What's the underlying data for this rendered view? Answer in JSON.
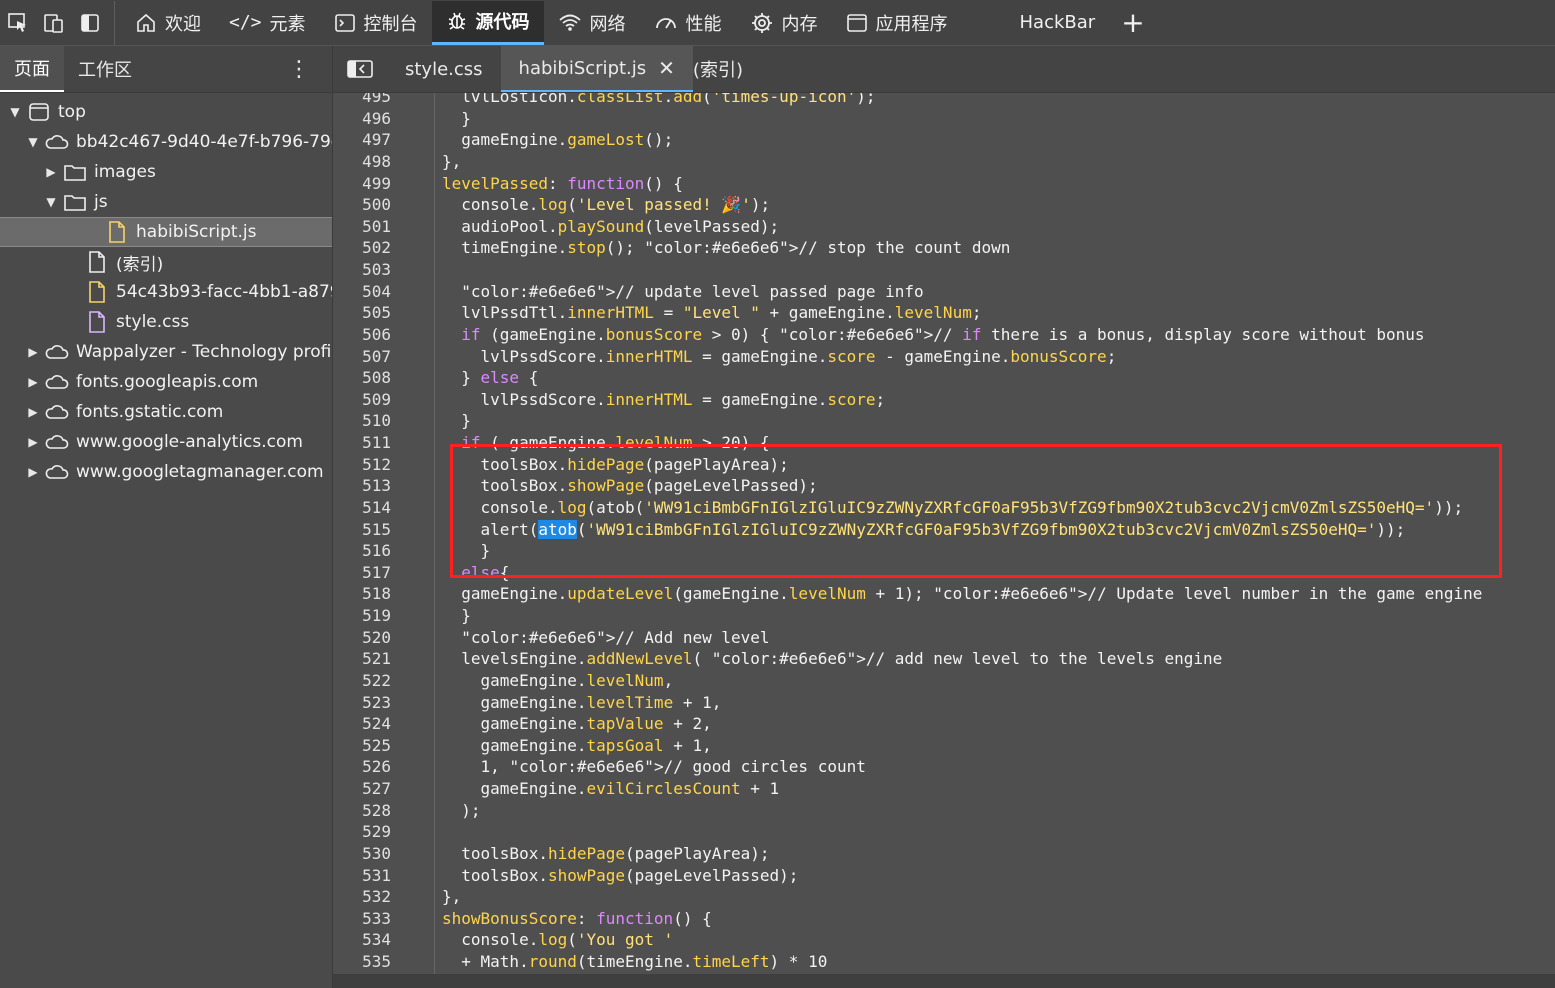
{
  "topbar": {
    "tabs": [
      {
        "icon": "home-icon",
        "label": "欢迎"
      },
      {
        "icon": "elements-icon",
        "label": "元素"
      },
      {
        "icon": "console-icon",
        "label": "控制台"
      },
      {
        "icon": "sources-bug-icon",
        "label": "源代码"
      },
      {
        "icon": "wifi-icon",
        "label": "网络"
      },
      {
        "icon": "performance-icon",
        "label": "性能"
      },
      {
        "icon": "memory-gear-icon",
        "label": "内存"
      },
      {
        "icon": "application-icon",
        "label": "应用程序"
      },
      {
        "icon": "",
        "label": "HackBar"
      }
    ],
    "plus": "+"
  },
  "sidebar": {
    "tabs": [
      "页面",
      "工作区"
    ],
    "kebab": "⋮",
    "tree": [
      {
        "label": "top",
        "icon": "window-icon",
        "caret": "▼"
      },
      {
        "label": "bb42c467-9d40-4e7f-b796-79e",
        "icon": "cloud-icon",
        "caret": "▼"
      },
      {
        "label": "images",
        "icon": "folder-icon",
        "caret": "▶"
      },
      {
        "label": "js",
        "icon": "folder-icon",
        "caret": "▼"
      },
      {
        "label": "habibiScript.js",
        "icon": "js-file-icon",
        "caret": ""
      },
      {
        "label": "(索引)",
        "icon": "file-icon",
        "caret": ""
      },
      {
        "label": "54c43b93-facc-4bb1-a879-0e",
        "icon": "js-file-icon",
        "caret": ""
      },
      {
        "label": "style.css",
        "icon": "css-file-icon",
        "caret": ""
      },
      {
        "label": "Wappalyzer - Technology profile",
        "icon": "cloud-icon",
        "caret": "▶"
      },
      {
        "label": "fonts.googleapis.com",
        "icon": "cloud-icon",
        "caret": "▶"
      },
      {
        "label": "fonts.gstatic.com",
        "icon": "cloud-icon",
        "caret": "▶"
      },
      {
        "label": "www.google-analytics.com",
        "icon": "cloud-icon",
        "caret": "▶"
      },
      {
        "label": "www.googletagmanager.com",
        "icon": "cloud-icon",
        "caret": "▶"
      }
    ]
  },
  "editor": {
    "tabs": [
      {
        "label": "style.css"
      },
      {
        "label": "habibiScript.js",
        "close": "✕"
      },
      {
        "label": "(索引)"
      }
    ],
    "lines": [
      {
        "n": "495",
        "t": "  lvlLostIcon.classList.add('times-up-icon');"
      },
      {
        "n": "496",
        "t": "  }"
      },
      {
        "n": "497",
        "t": "  gameEngine.gameLost();"
      },
      {
        "n": "498",
        "t": "},"
      },
      {
        "n": "499",
        "t": "levelPassed: function() {"
      },
      {
        "n": "500",
        "t": "  console.log('Level passed! 🎉');"
      },
      {
        "n": "501",
        "t": "  audioPool.playSound(levelPassed);"
      },
      {
        "n": "502",
        "t": "  timeEngine.stop(); // stop the count down"
      },
      {
        "n": "503",
        "t": ""
      },
      {
        "n": "504",
        "t": "  // update level passed page info"
      },
      {
        "n": "505",
        "t": "  lvlPssdTtl.innerHTML = \"Level \" + gameEngine.levelNum;"
      },
      {
        "n": "506",
        "t": "  if (gameEngine.bonusScore > 0) { // if there is a bonus, display score without bonus"
      },
      {
        "n": "507",
        "t": "    lvlPssdScore.innerHTML = gameEngine.score - gameEngine.bonusScore;"
      },
      {
        "n": "508",
        "t": "  } else {"
      },
      {
        "n": "509",
        "t": "    lvlPssdScore.innerHTML = gameEngine.score;"
      },
      {
        "n": "510",
        "t": "  }"
      },
      {
        "n": "511",
        "t": "  if ( gameEngine.levelNum > 20) {"
      },
      {
        "n": "512",
        "t": "    toolsBox.hidePage(pagePlayArea);"
      },
      {
        "n": "513",
        "t": "    toolsBox.showPage(pageLevelPassed);"
      },
      {
        "n": "514",
        "t": "    console.log(atob('WW91ciBmbGFnIGlzIGluIC9zZWNyZXRfcGF0aF95b3VfZG9fbm90X2tub3cvc2VjcmV0ZmlsZS50eHQ='));"
      },
      {
        "n": "515",
        "t": "    alert(atob('WW91ciBmbGFnIGlzIGluIC9zZWNyZXRfcGF0aF95b3VfZG9fbm90X2tub3cvc2VjcmV0ZmlsZS50eHQ='));"
      },
      {
        "n": "516",
        "t": "    }"
      },
      {
        "n": "517",
        "t": "  else{"
      },
      {
        "n": "518",
        "t": "  gameEngine.updateLevel(gameEngine.levelNum + 1); // Update level number in the game engine"
      },
      {
        "n": "519",
        "t": "  }"
      },
      {
        "n": "520",
        "t": "  // Add new level"
      },
      {
        "n": "521",
        "t": "  levelsEngine.addNewLevel( // add new level to the levels engine"
      },
      {
        "n": "522",
        "t": "    gameEngine.levelNum,"
      },
      {
        "n": "523",
        "t": "    gameEngine.levelTime + 1,"
      },
      {
        "n": "524",
        "t": "    gameEngine.tapValue + 2,"
      },
      {
        "n": "525",
        "t": "    gameEngine.tapsGoal + 1,"
      },
      {
        "n": "526",
        "t": "    1, // good circles count"
      },
      {
        "n": "527",
        "t": "    gameEngine.evilCirclesCount + 1"
      },
      {
        "n": "528",
        "t": "  );"
      },
      {
        "n": "529",
        "t": ""
      },
      {
        "n": "530",
        "t": "  toolsBox.hidePage(pagePlayArea);"
      },
      {
        "n": "531",
        "t": "  toolsBox.showPage(pageLevelPassed);"
      },
      {
        "n": "532",
        "t": "},"
      },
      {
        "n": "533",
        "t": "showBonusScore: function() {"
      },
      {
        "n": "534",
        "t": "  console.log('You got '"
      },
      {
        "n": "535",
        "t": "  + Math.round(timeEngine.timeLeft) * 10"
      }
    ]
  },
  "colors": {
    "accent": "#5fb6ff",
    "highlight_box": "#ff2020",
    "keyword": "#dd88ff",
    "property": "#ffd54a",
    "string": "#ffe27a"
  }
}
